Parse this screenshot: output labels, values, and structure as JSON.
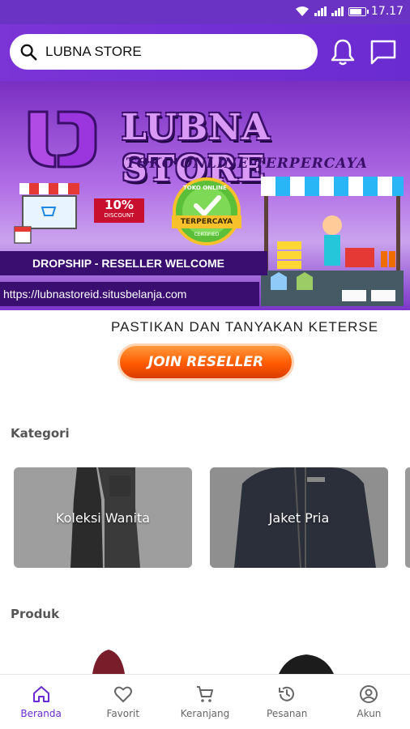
{
  "status_bar": {
    "time": "17.17"
  },
  "search": {
    "value": "LUBNA STORE"
  },
  "banner": {
    "brand": "LUBNA STORE",
    "tagline": "TOKO ONLINE TERPERCAYA",
    "discount_percent": "10%",
    "discount_label": "DISCOUNT",
    "seal_text": "TOKO ONLINE",
    "seal_ribbon": "TERPERCAYA",
    "seal_bottom": "CERTIFIED",
    "strip": "DROPSHIP - RESELLER WELCOME",
    "url": "https://lubnastoreid.situsbelanja.com"
  },
  "announcement": "PASTIKAN DAN TANYAKAN KETERSE",
  "join_button": "JOIN RESELLER",
  "sections": {
    "kategori": "Kategori",
    "produk": "Produk"
  },
  "categories": [
    {
      "label": "Koleksi Wanita"
    },
    {
      "label": "Jaket Pria"
    }
  ],
  "bottom_nav": [
    {
      "label": "Beranda",
      "icon": "home-icon",
      "active": true
    },
    {
      "label": "Favorit",
      "icon": "heart-icon",
      "active": false
    },
    {
      "label": "Keranjang",
      "icon": "cart-icon",
      "active": false
    },
    {
      "label": "Pesanan",
      "icon": "history-icon",
      "active": false
    },
    {
      "label": "Akun",
      "icon": "account-icon",
      "active": false
    }
  ],
  "colors": {
    "primary": "#6a2bd1",
    "accent": "#ff5a00",
    "banner_dark": "#3a0d70"
  }
}
